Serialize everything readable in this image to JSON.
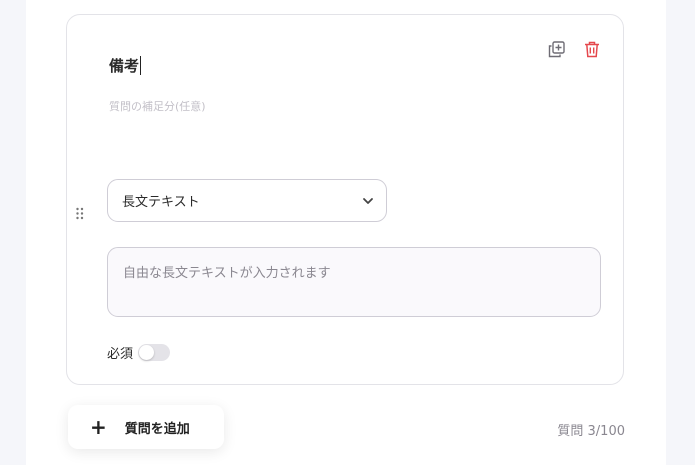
{
  "question": {
    "title": "備考",
    "subtitle_placeholder": "質問の補足分(任意)",
    "type_select": {
      "selected": "長文テキスト"
    },
    "answer_placeholder": "自由な長文テキストが入力されます",
    "required_label": "必須",
    "required_on": false
  },
  "actions": {
    "duplicate_icon": "duplicate-icon",
    "delete_icon": "trash-icon",
    "drag_icon": "drag-handle-icon"
  },
  "footer": {
    "add_question_label": "質問を追加",
    "counter_label": "質問 3/100"
  },
  "colors": {
    "delete": "#e5484d",
    "border": "#cfcdd6",
    "placeholder": "#c3c0c8"
  }
}
